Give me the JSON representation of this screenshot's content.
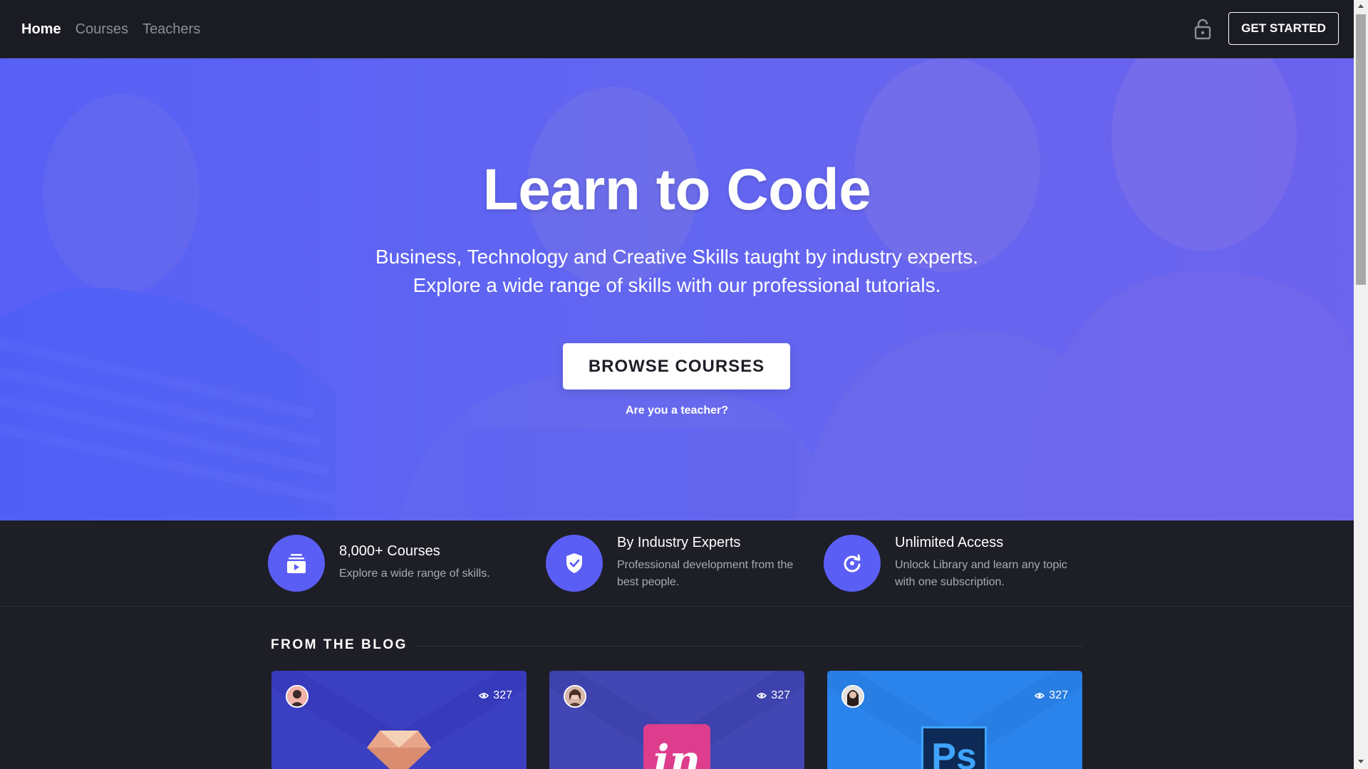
{
  "nav": {
    "links": [
      {
        "label": "Home",
        "active": true
      },
      {
        "label": "Courses",
        "active": false
      },
      {
        "label": "Teachers",
        "active": false
      }
    ],
    "cta_label": "GET STARTED",
    "lock_icon": "lock-open-icon"
  },
  "hero": {
    "title": "Learn to Code",
    "subtitle_line1": "Business, Technology and Creative Skills taught by industry experts.",
    "subtitle_line2": "Explore a wide range of skills with our professional tutorials.",
    "browse_label": "BROWSE COURSES",
    "teacher_link": "Are you a teacher?"
  },
  "features": [
    {
      "icon": "video-library-icon",
      "title": "8,000+ Courses",
      "desc": "Explore a wide range of skills."
    },
    {
      "icon": "verified-shield-icon",
      "title": "By Industry Experts",
      "desc": "Professional development from the best people."
    },
    {
      "icon": "refresh-icon",
      "title": "Unlimited Access",
      "desc": "Unlock Library and learn any topic with one subscription."
    }
  ],
  "blog": {
    "heading": "FROM THE BLOG",
    "cards": [
      {
        "views": "327",
        "logo": "sketch-diamond-icon",
        "bg": "#3b3fc2"
      },
      {
        "views": "327",
        "logo": "invision-icon",
        "bg": "#4247b4",
        "logo_text": "in"
      },
      {
        "views": "327",
        "logo": "photoshop-icon",
        "bg": "#2b84ec",
        "logo_text": "Ps"
      }
    ]
  },
  "colors": {
    "accent": "#5b5ef5",
    "background": "#1d1e26",
    "navbar": "#1b1c23"
  }
}
